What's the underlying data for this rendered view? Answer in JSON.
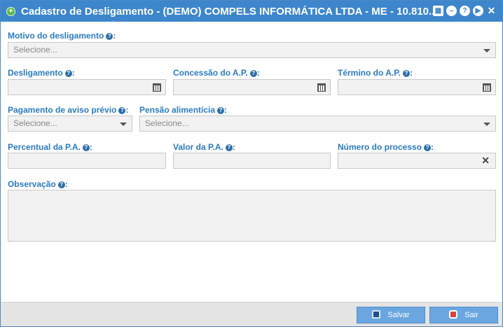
{
  "window": {
    "title": "Cadastro de Desligamento - (DEMO) COMPELS INFORMÁTICA LTDA - ME - 10.810...."
  },
  "icons": {
    "add": "plus-circle-icon",
    "calendar": "calendar-icon",
    "minimize": "minimize-icon",
    "help": "help-icon",
    "next": "play-icon",
    "close": "close-icon"
  },
  "form": {
    "motivo": {
      "label": "Motivo do desligamento",
      "placeholder": "Selecione..."
    },
    "desligamento": {
      "label": "Desligamento",
      "value": ""
    },
    "concessao": {
      "label": "Concessão do A.P.",
      "value": ""
    },
    "termino": {
      "label": "Término do A.P.",
      "value": ""
    },
    "pagamento": {
      "label": "Pagamento de aviso prévio",
      "placeholder": "Selecione..."
    },
    "pensao": {
      "label": "Pensão alimentícia",
      "placeholder": "Selecione..."
    },
    "percentual": {
      "label": "Percentual da P.A.",
      "value": ""
    },
    "valor": {
      "label": "Valor da P.A.",
      "value": ""
    },
    "numero": {
      "label": "Número do processo",
      "value": ""
    },
    "observacao": {
      "label": "Observação",
      "value": ""
    }
  },
  "footer": {
    "save_label": "Salvar",
    "exit_label": "Sair"
  },
  "colors": {
    "titlebar": "#3d86cc",
    "label": "#2b7bc0",
    "button": "#6aa6e0"
  }
}
